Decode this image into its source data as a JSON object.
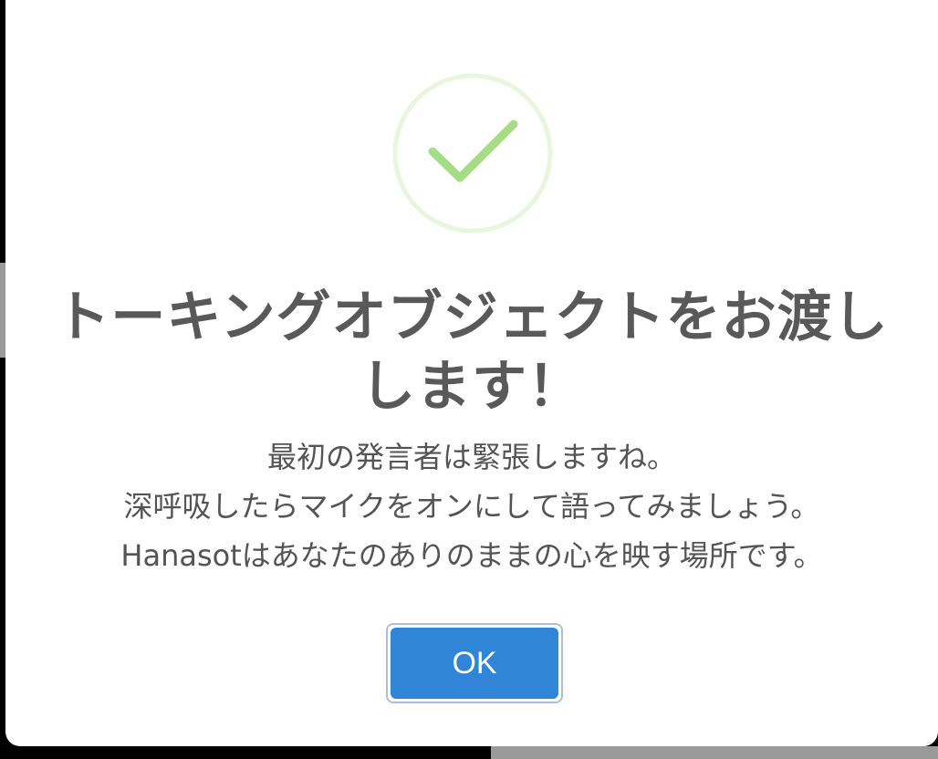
{
  "dialog": {
    "icon": "success-check-icon",
    "title": "トーキングオブジェクトをお渡しします！",
    "message_lines": [
      "最初の発言者は緊張しますね。",
      "深呼吸したらマイクをオンにして語ってみましょう。",
      "Hanasotはあなたのありのままの心を映す場所です。"
    ],
    "confirm_label": "OK"
  },
  "colors": {
    "check": "#a5dc86",
    "check_ring": "#e8f6de",
    "confirm_button": "#3085d6",
    "title_text": "#595959"
  }
}
